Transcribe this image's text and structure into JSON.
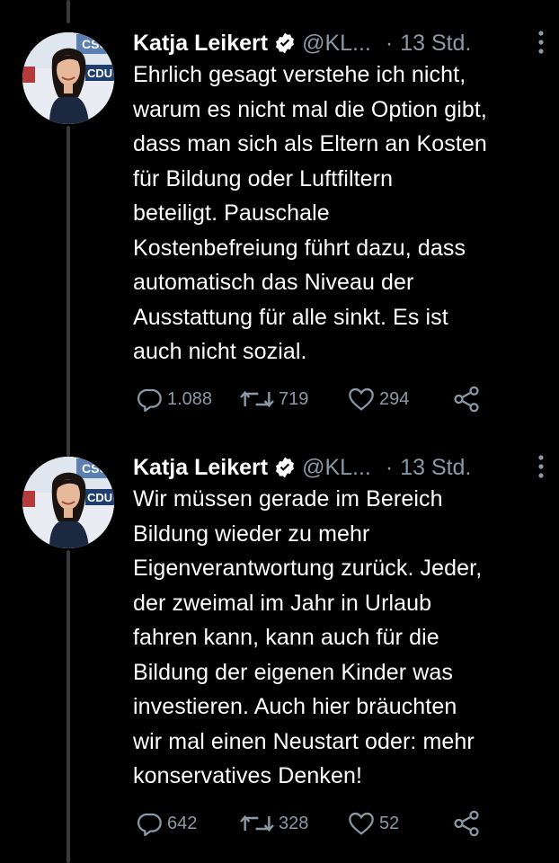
{
  "tweets": [
    {
      "author_name": "Katja Leikert",
      "handle": "@KL...",
      "separator": "·",
      "time": "13 Std.",
      "text": "Ehrlich gesagt verstehe ich nicht,\nwarum es nicht mal die Option gibt,\ndass man sich als Eltern an Kosten\nfür Bildung oder Luftfiltern\nbeteiligt. Pauschale\nKostenbefreiung führt dazu, dass\nautomatisch das Niveau der\nAusstattung für alle sinkt. Es ist\nauch nicht sozial.",
      "replies": "1.088",
      "retweets": "719",
      "likes": "294"
    },
    {
      "author_name": "Katja Leikert",
      "handle": "@KL...",
      "separator": "·",
      "time": "13 Std.",
      "text": "Wir müssen gerade im Bereich\nBildung wieder zu mehr\nEigenverantwortung zurück. Jeder,\nder zweimal im Jahr in Urlaub\nfahren kann, kann auch für die\nBildung der eigenen Kinder was\ninvestieren. Auch hier bräuchten\nwir mal einen Neustart oder: mehr\nkonservatives Denken!",
      "replies": "642",
      "retweets": "328",
      "likes": "52"
    }
  ],
  "icons": {
    "verified": "verified-badge-icon",
    "more": "more-vertical-icon",
    "reply": "reply-icon",
    "retweet": "retweet-icon",
    "like": "heart-icon",
    "share": "share-icon"
  },
  "colors": {
    "background": "#000000",
    "text": "#ffffff",
    "muted": "#8b98a5",
    "thread_line": "#3a3a3a"
  },
  "avatar_logos": {
    "csu": "CSU",
    "cdu": "CDU"
  }
}
